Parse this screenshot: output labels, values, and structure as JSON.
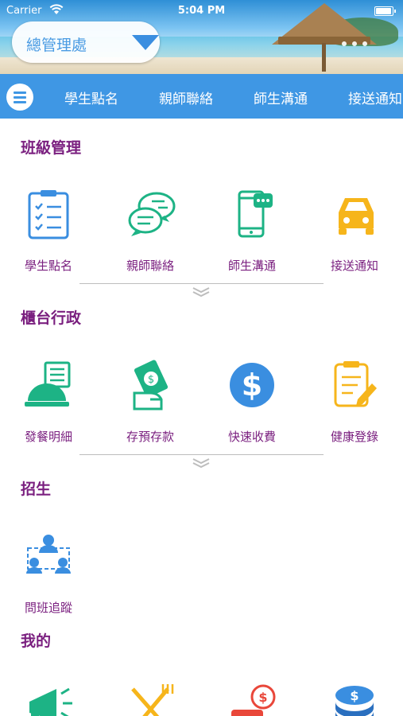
{
  "status_bar": {
    "carrier": "Carrier",
    "time": "5:04 PM"
  },
  "header": {
    "school_selector": "總管理處"
  },
  "top_nav": {
    "items": [
      "學生點名",
      "親師聯絡",
      "師生溝通",
      "接送通知"
    ]
  },
  "sections": [
    {
      "title": "班級管理",
      "items": [
        {
          "label": "學生點名",
          "icon": "clipboard-checklist-icon"
        },
        {
          "label": "親師聯絡",
          "icon": "chat-bubbles-icon"
        },
        {
          "label": "師生溝通",
          "icon": "phone-message-icon"
        },
        {
          "label": "接送通知",
          "icon": "car-icon"
        }
      ]
    },
    {
      "title": "櫃台行政",
      "items": [
        {
          "label": "發餐明細",
          "icon": "meal-cloche-icon"
        },
        {
          "label": "存預存款",
          "icon": "money-hand-icon"
        },
        {
          "label": "快速收費",
          "icon": "dollar-circle-icon"
        },
        {
          "label": "健康登錄",
          "icon": "health-clipboard-icon"
        }
      ]
    },
    {
      "title": "招生",
      "items": [
        {
          "label": "問班追蹤",
          "icon": "people-network-icon"
        }
      ]
    },
    {
      "title": "我的",
      "items": [
        {
          "label": "",
          "icon": "megaphone-icon"
        },
        {
          "label": "",
          "icon": "fork-knife-icon"
        },
        {
          "label": "",
          "icon": "money-hand-red-icon"
        },
        {
          "label": "",
          "icon": "coin-stack-icon"
        }
      ]
    }
  ],
  "colors": {
    "nav_blue": "#3f97e4",
    "section_purple": "#7a1f7f",
    "green": "#1db385",
    "blue": "#3a8ee0",
    "orange": "#f6b51b",
    "red": "#e9473a"
  }
}
